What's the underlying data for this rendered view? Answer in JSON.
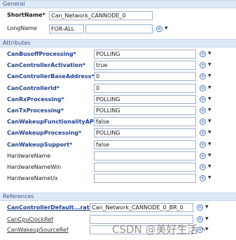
{
  "sections": {
    "general": "General",
    "attributes": "Attributes",
    "references": "References"
  },
  "general": {
    "short_name_label": "ShortName*",
    "short_name_value": "Can_Network_CANNODE_0",
    "long_name_label": "LongName",
    "long_name_lang": "FOR-ALL",
    "long_name_value": ""
  },
  "attributes": [
    {
      "label": "CanBusoffProcessing*",
      "value": "POLLING"
    },
    {
      "label": "CanControllerActivation*",
      "value": "true"
    },
    {
      "label": "CanControllerBaseAddress*",
      "value": "0"
    },
    {
      "label": "CanControllerId*",
      "value": "0"
    },
    {
      "label": "CanRxProcessing*",
      "value": "POLLING"
    },
    {
      "label": "CanTxProcessing*",
      "value": "POLLING"
    },
    {
      "label": "CanWakeupFunctionalityAPI*",
      "value": "false"
    },
    {
      "label": "CanWakeupProcessing*",
      "value": "POLLING"
    },
    {
      "label": "CanWakeupSupport*",
      "value": "false"
    },
    {
      "label": "HardwareName",
      "value": ""
    },
    {
      "label": "HardwareNameWin",
      "value": ""
    },
    {
      "label": "HardwareNameUx",
      "value": ""
    }
  ],
  "references": [
    {
      "label": "CanControllerDefault...rate*",
      "value": "Can_Network_CANNODE_0_BR_0"
    },
    {
      "label": "CanCpuClockRef",
      "value": ""
    },
    {
      "label": "CanWakeupSourceRef",
      "value": ""
    }
  ],
  "icons": {
    "clear": "clear-x-icon",
    "dropdown": "chevron-down-icon",
    "clear_glyph": "⊗",
    "dropdown_glyph": "▼"
  },
  "watermark": "CSDN @美好生活丶"
}
